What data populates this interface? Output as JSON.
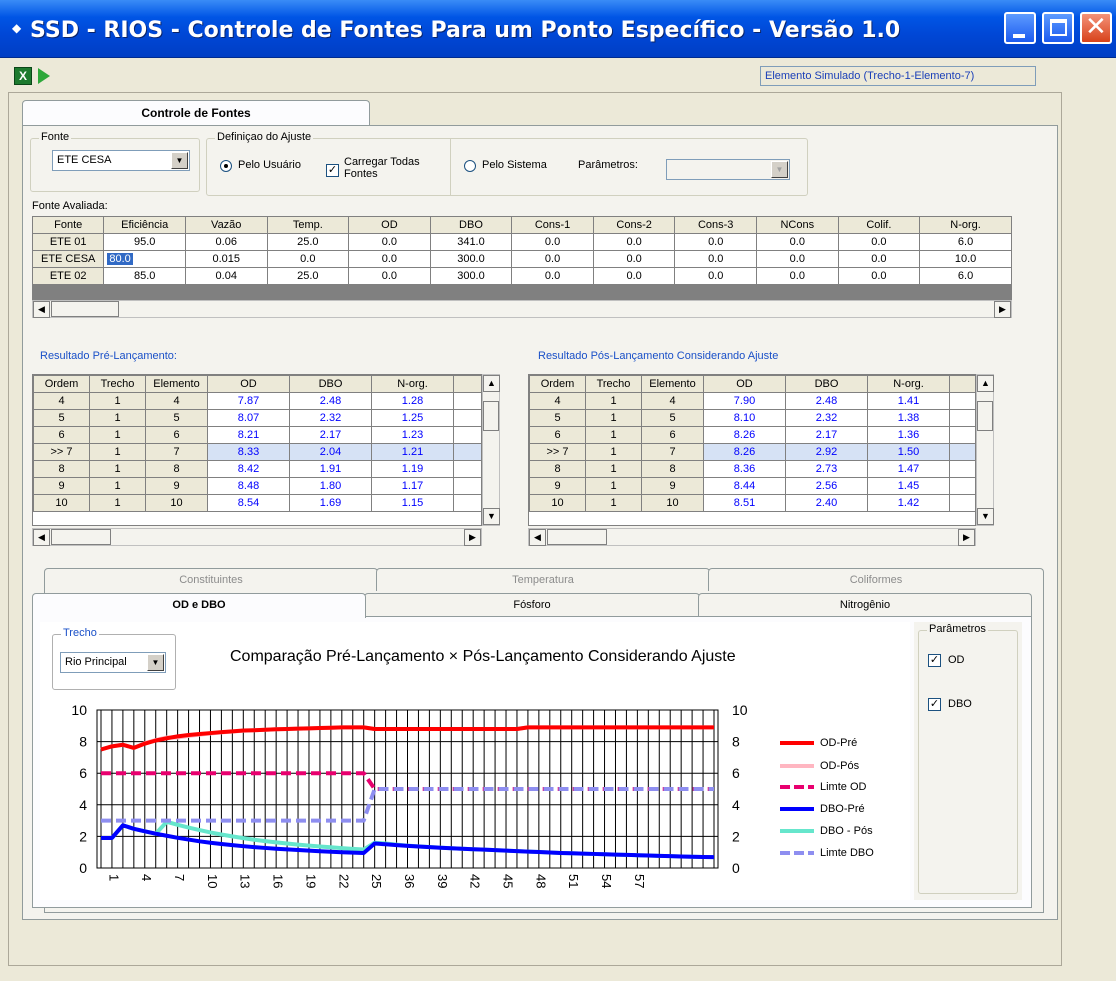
{
  "window": {
    "title": "SSD - RIOS - Controle de Fontes Para um Ponto Específico - Versão 1.0",
    "status": "Elemento Simulado (Trecho-1-Elemento-7)"
  },
  "main_tab": "Controle de Fontes",
  "fonte": {
    "group_label": "Fonte",
    "selected": "ETE CESA"
  },
  "ajuste": {
    "group_label": "Definiçao do Ajuste",
    "pelo_usuario": "Pelo Usuário",
    "carregar": "Carregar Todas Fontes",
    "pelo_sistema": "Pelo Sistema",
    "parametros_label": "Parâmetros:",
    "parametros_value": ""
  },
  "fonte_avaliada": {
    "label": "Fonte Avaliada:",
    "columns": [
      "Fonte",
      "Eficiência",
      "Vazão",
      "Temp.",
      "OD",
      "DBO",
      "Cons-1",
      "Cons-2",
      "Cons-3",
      "NCons",
      "Colif.",
      "N-org."
    ],
    "rows": [
      [
        "ETE 01",
        "95.0",
        "0.06",
        "25.0",
        "0.0",
        "341.0",
        "0.0",
        "0.0",
        "0.0",
        "0.0",
        "0.0",
        "6.0"
      ],
      [
        "ETE CESA",
        "80.0",
        "0.015",
        "0.0",
        "0.0",
        "300.0",
        "0.0",
        "0.0",
        "0.0",
        "0.0",
        "0.0",
        "10.0"
      ],
      [
        "ETE 02",
        "85.0",
        "0.04",
        "25.0",
        "0.0",
        "300.0",
        "0.0",
        "0.0",
        "0.0",
        "0.0",
        "0.0",
        "6.0"
      ]
    ]
  },
  "pre": {
    "title": "Resultado Pré-Lançamento:",
    "columns": [
      "Ordem",
      "Trecho",
      "Elemento",
      "OD",
      "DBO",
      "N-org."
    ],
    "rows": [
      [
        "4",
        "1",
        "4",
        "7.87",
        "2.48",
        "1.28"
      ],
      [
        "5",
        "1",
        "5",
        "8.07",
        "2.32",
        "1.25"
      ],
      [
        "6",
        "1",
        "6",
        "8.21",
        "2.17",
        "1.23"
      ],
      [
        ">> 7",
        "1",
        "7",
        "8.33",
        "2.04",
        "1.21"
      ],
      [
        "8",
        "1",
        "8",
        "8.42",
        "1.91",
        "1.19"
      ],
      [
        "9",
        "1",
        "9",
        "8.48",
        "1.80",
        "1.17"
      ],
      [
        "10",
        "1",
        "10",
        "8.54",
        "1.69",
        "1.15"
      ]
    ]
  },
  "pos": {
    "title": "Resultado Pós-Lançamento Considerando Ajuste",
    "columns": [
      "Ordem",
      "Trecho",
      "Elemento",
      "OD",
      "DBO",
      "N-org."
    ],
    "rows": [
      [
        "4",
        "1",
        "4",
        "7.90",
        "2.48",
        "1.41"
      ],
      [
        "5",
        "1",
        "5",
        "8.10",
        "2.32",
        "1.38"
      ],
      [
        "6",
        "1",
        "6",
        "8.26",
        "2.17",
        "1.36"
      ],
      [
        ">> 7",
        "1",
        "7",
        "8.26",
        "2.92",
        "1.50"
      ],
      [
        "8",
        "1",
        "8",
        "8.36",
        "2.73",
        "1.47"
      ],
      [
        "9",
        "1",
        "9",
        "8.44",
        "2.56",
        "1.45"
      ],
      [
        "10",
        "1",
        "10",
        "8.51",
        "2.40",
        "1.42"
      ]
    ]
  },
  "tabs_back": [
    "Constituintes",
    "Temperatura",
    "Coliformes"
  ],
  "tabs_front": [
    "OD e DBO",
    "Fósforo",
    "Nitrogênio"
  ],
  "trecho": {
    "group_label": "Trecho",
    "selected": "Rio Principal"
  },
  "parametros": {
    "group_label": "Parâmetros",
    "od": "OD",
    "dbo": "DBO"
  },
  "colors": {
    "od_pre": "#ff0000",
    "od_pos": "#ffb6c1",
    "limite_od": "#e8006f",
    "dbo_pre": "#0000ff",
    "dbo_pos": "#66e6cc",
    "limite_dbo": "#8e8ef0"
  },
  "chart_data": {
    "type": "line",
    "title": "Comparação Pré-Lançamento × Pós-Lançamento Considerando Ajuste",
    "x_tick_labels": [
      "1",
      "4",
      "7",
      "10",
      "13",
      "16",
      "19",
      "22",
      "25",
      "36",
      "39",
      "42",
      "45",
      "48",
      "51",
      "54",
      "57"
    ],
    "ylim": [
      0,
      10
    ],
    "y_ticks": [
      0,
      2,
      4,
      6,
      8,
      10
    ],
    "grid": true,
    "legend_position": "right",
    "series": [
      {
        "name": "OD-Pré",
        "color_key": "od_pre",
        "dash": false,
        "values": [
          7.5,
          7.7,
          7.8,
          7.6,
          7.87,
          8.07,
          8.21,
          8.33,
          8.42,
          8.48,
          8.54,
          8.6,
          8.65,
          8.7,
          8.72,
          8.75,
          8.78,
          8.8,
          8.82,
          8.84,
          8.86,
          8.88,
          8.9,
          8.9,
          8.9,
          8.8,
          8.8,
          8.8,
          8.8,
          8.8,
          8.8,
          8.8,
          8.8,
          8.8,
          8.8,
          8.8,
          8.8,
          8.8,
          8.8,
          8.9,
          8.9,
          8.9,
          8.9,
          8.9,
          8.9,
          8.9,
          8.9,
          8.9,
          8.9,
          8.9,
          8.9,
          8.9,
          8.9,
          8.9,
          8.9,
          8.9,
          8.9
        ]
      },
      {
        "name": "OD-Pós",
        "color_key": "od_pos",
        "dash": false,
        "values": [
          7.5,
          7.7,
          7.8,
          7.6,
          7.9,
          8.1,
          8.26,
          8.26,
          8.36,
          8.44,
          8.51,
          8.58,
          8.64,
          8.69,
          8.72,
          8.75,
          8.78,
          8.8,
          8.82,
          8.84,
          8.86,
          8.88,
          8.9,
          8.9,
          8.9,
          8.8,
          8.8,
          8.8,
          8.8,
          8.8,
          8.8,
          8.8,
          8.8,
          8.8,
          8.8,
          8.8,
          8.8,
          8.8,
          8.8,
          8.9,
          8.9,
          8.9,
          8.9,
          8.9,
          8.9,
          8.9,
          8.9,
          8.9,
          8.9,
          8.9,
          8.9,
          8.9,
          8.9,
          8.9,
          8.9,
          8.9,
          8.9
        ]
      },
      {
        "name": "Limte OD",
        "color_key": "limite_od",
        "dash": true,
        "values": [
          6,
          6,
          6,
          6,
          6,
          6,
          6,
          6,
          6,
          6,
          6,
          6,
          6,
          6,
          6,
          6,
          6,
          6,
          6,
          6,
          6,
          6,
          6,
          6,
          6,
          5,
          5,
          5,
          5,
          5,
          5,
          5,
          5,
          5,
          5,
          5,
          5,
          5,
          5,
          5,
          5,
          5,
          5,
          5,
          5,
          5,
          5,
          5,
          5,
          5,
          5,
          5,
          5,
          5,
          5,
          5,
          5
        ]
      },
      {
        "name": "DBO-Pré",
        "color_key": "dbo_pre",
        "dash": false,
        "values": [
          1.9,
          1.9,
          2.7,
          2.48,
          2.32,
          2.17,
          2.04,
          1.91,
          1.8,
          1.69,
          1.6,
          1.52,
          1.45,
          1.38,
          1.32,
          1.27,
          1.22,
          1.18,
          1.14,
          1.1,
          1.06,
          1.03,
          1.0,
          0.97,
          0.95,
          1.55,
          1.5,
          1.45,
          1.4,
          1.36,
          1.32,
          1.28,
          1.25,
          1.22,
          1.19,
          1.16,
          1.13,
          1.1,
          1.07,
          1.04,
          1.01,
          0.98,
          0.95,
          0.93,
          0.91,
          0.89,
          0.87,
          0.85,
          0.83,
          0.81,
          0.79,
          0.77,
          0.75,
          0.73,
          0.71,
          0.7,
          0.69
        ]
      },
      {
        "name": "DBO - Pós",
        "color_key": "dbo_pos",
        "dash": false,
        "values": [
          1.9,
          1.9,
          2.7,
          2.48,
          2.32,
          2.17,
          2.92,
          2.73,
          2.56,
          2.4,
          2.25,
          2.12,
          2.0,
          1.89,
          1.79,
          1.7,
          1.62,
          1.55,
          1.48,
          1.42,
          1.36,
          1.31,
          1.26,
          1.21,
          1.17,
          1.6,
          1.55,
          1.48,
          1.42,
          1.37,
          1.33,
          1.29,
          1.25,
          1.22,
          1.19,
          1.16,
          1.13,
          1.1,
          1.07,
          1.04,
          1.01,
          0.98,
          0.95,
          0.93,
          0.91,
          0.89,
          0.87,
          0.85,
          0.83,
          0.81,
          0.79,
          0.77,
          0.75,
          0.73,
          0.71,
          0.7,
          0.69
        ]
      },
      {
        "name": "Limte DBO",
        "color_key": "limite_dbo",
        "dash": true,
        "values": [
          3,
          3,
          3,
          3,
          3,
          3,
          3,
          3,
          3,
          3,
          3,
          3,
          3,
          3,
          3,
          3,
          3,
          3,
          3,
          3,
          3,
          3,
          3,
          3,
          3,
          5,
          5,
          5,
          5,
          5,
          5,
          5,
          5,
          5,
          5,
          5,
          5,
          5,
          5,
          5,
          5,
          5,
          5,
          5,
          5,
          5,
          5,
          5,
          5,
          5,
          5,
          5,
          5,
          5,
          5,
          5,
          5
        ]
      }
    ]
  }
}
